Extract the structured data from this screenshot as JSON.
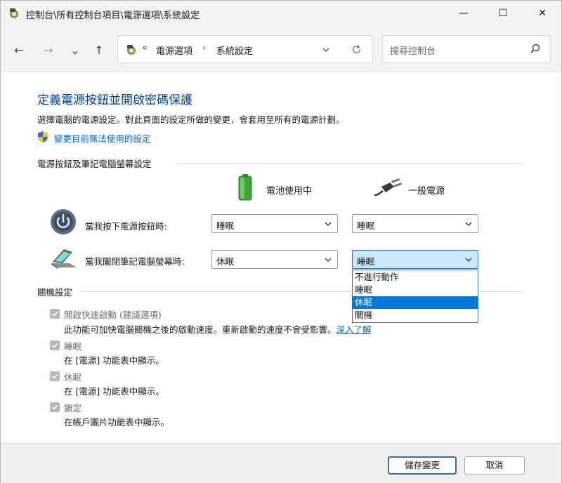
{
  "window": {
    "title": "控制台\\所有控制台項目\\電源選項\\系統設定",
    "minimize_glyph": "—",
    "maximize_glyph": "☐",
    "close_glyph": "✕"
  },
  "nav": {
    "back_glyph": "←",
    "forward_glyph": "→",
    "recent_glyph": "⌄",
    "up_glyph": "↑",
    "breadcrumb_overflow": "«",
    "breadcrumb": [
      "電源選項",
      "系統設定"
    ],
    "breadcrumb_sep": "›",
    "search_placeholder": "搜尋控制台"
  },
  "main": {
    "heading": "定義電源按鈕並開啟密碼保護",
    "subtitle": "選擇電腦的電源設定。對此頁面的設定所做的變更，會套用至所有的電源計劃。",
    "admin_link": "變更目前無法使用的設定",
    "power_section_title": "電源按鈕及筆記電腦螢幕設定",
    "col_battery": "電池使用中",
    "col_plugged": "一般電源",
    "row_power_button": {
      "label": "當我按下電源按鈕時:",
      "battery_value": "睡眠",
      "plugged_value": "睡眠"
    },
    "row_lid": {
      "label": "當我闔閉筆記電腦螢幕時:",
      "battery_value": "休眠",
      "plugged_value": "睡眠"
    },
    "dropdown_options": [
      "不進行動作",
      "睡眠",
      "休眠",
      "關機"
    ],
    "dropdown_selected_index": 2,
    "shutdown_section_title": "關機設定",
    "fast_startup": {
      "label": "開啟快速啟動 (建議選項)",
      "desc": "此功能可加快電腦關機之後的啟動速度。重新啟動的速度不會受影響。",
      "link": "深入了解"
    },
    "sleep": {
      "label": "睡眠",
      "desc": "在 [電源] 功能表中顯示。"
    },
    "hibernate": {
      "label": "休眠",
      "desc": "在 [電源] 功能表中顯示。"
    },
    "lock": {
      "label": "鎖定",
      "desc": "在帳戶圖片功能表中顯示。"
    }
  },
  "footer": {
    "save_label": "儲存變更",
    "cancel_label": "取消"
  },
  "colors": {
    "heading": "#003e92",
    "link": "#0066cc",
    "selection": "#0078d7",
    "focus_fill": "#cce8ff"
  }
}
